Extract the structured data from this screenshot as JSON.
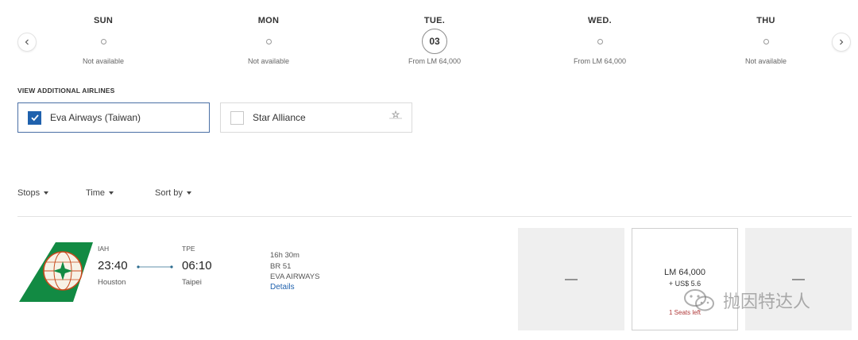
{
  "date_strip": {
    "days": [
      {
        "name": "SUN",
        "status": "Not available"
      },
      {
        "name": "MON",
        "status": "Not available"
      },
      {
        "name": "TUE.",
        "date": "03",
        "status": "From LM 64,000"
      },
      {
        "name": "WED.",
        "status": "From LM 64,000"
      },
      {
        "name": "THU",
        "status": "Not available"
      }
    ]
  },
  "airlines": {
    "heading": "VIEW ADDITIONAL AIRLINES",
    "options": [
      {
        "label": "Eva Airways (Taiwan)",
        "checked": true
      },
      {
        "label": "Star Alliance",
        "checked": false
      }
    ]
  },
  "filters": {
    "stops": "Stops",
    "time": "Time",
    "sort": "Sort by"
  },
  "flight": {
    "origin": {
      "code": "IAH",
      "time": "23:40",
      "city": "Houston"
    },
    "destination": {
      "code": "TPE",
      "time": "06:10",
      "city": "Taipei"
    },
    "duration": "16h 30m",
    "flight_number": "BR 51",
    "carrier": "EVA AIRWAYS",
    "details_label": "Details",
    "fares": {
      "left": "—",
      "center_price": "LM 64,000",
      "center_tax": "+ US$ 5.6",
      "center_seats": "1 Seats left",
      "right": "—"
    }
  },
  "watermark": {
    "text": "抛因特达人"
  },
  "colors": {
    "accent_blue": "#1f61ad",
    "eva_green": "#0f7a3a",
    "warning_red": "#b03a3a",
    "empty_fare_bg": "#efefef"
  }
}
